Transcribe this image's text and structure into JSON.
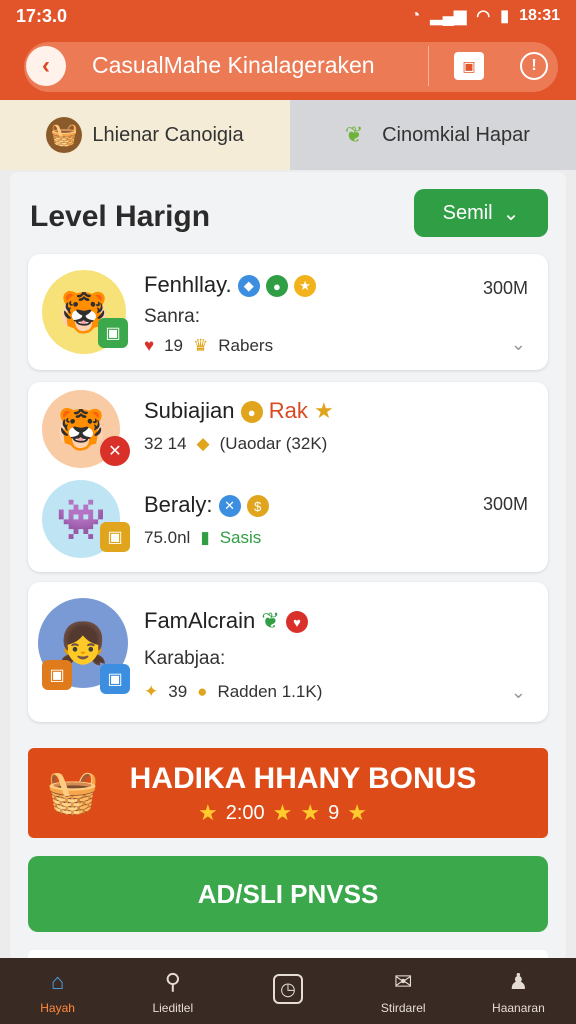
{
  "status": {
    "left": "17:3.0",
    "right": "18:31"
  },
  "appbar": {
    "title": "CasualMahe Kinalageraken",
    "back_label": "‹",
    "info_label": "!"
  },
  "tabs": [
    {
      "label": "Lhienar Canoigia",
      "icon": "basket-icon"
    },
    {
      "label": "Cinomkial Hapar",
      "icon": "leaf-icon"
    }
  ],
  "level": {
    "title": "Level Harign",
    "send_label": "Semil"
  },
  "cards": [
    {
      "name": "Fenhllay.",
      "sub": "Sanra:",
      "amount": "300M",
      "likes": "19",
      "tag": "Rabers"
    },
    {
      "name": "Subiajian",
      "name_extra": "Rak",
      "count": "32 14",
      "detail": "(Uaodar (32K)"
    },
    {
      "name": "Beraly:",
      "amount": "300M",
      "count": "75.0nl",
      "tag": "Sasis"
    },
    {
      "name": "FamAlcrain",
      "sub": "Karabjaa:",
      "count": "39",
      "detail": "Radden 1.1K)"
    }
  ],
  "bonus": {
    "title": "HADIKA HHANY BONUS",
    "value": "2:00",
    "extra": "9"
  },
  "pass_button": "AD/SLI PNVSS",
  "nav": [
    {
      "label": "Hayah",
      "icon": "home-icon"
    },
    {
      "label": "Lieditlel",
      "icon": "search-icon"
    },
    {
      "label": "",
      "icon": "clock-icon"
    },
    {
      "label": "Stirdarel",
      "icon": "chat-icon"
    },
    {
      "label": "Haanaran",
      "icon": "person-icon"
    }
  ],
  "colors": {
    "primary": "#e2542a",
    "green": "#3aa84b",
    "nav_bg": "#3a2a24"
  }
}
